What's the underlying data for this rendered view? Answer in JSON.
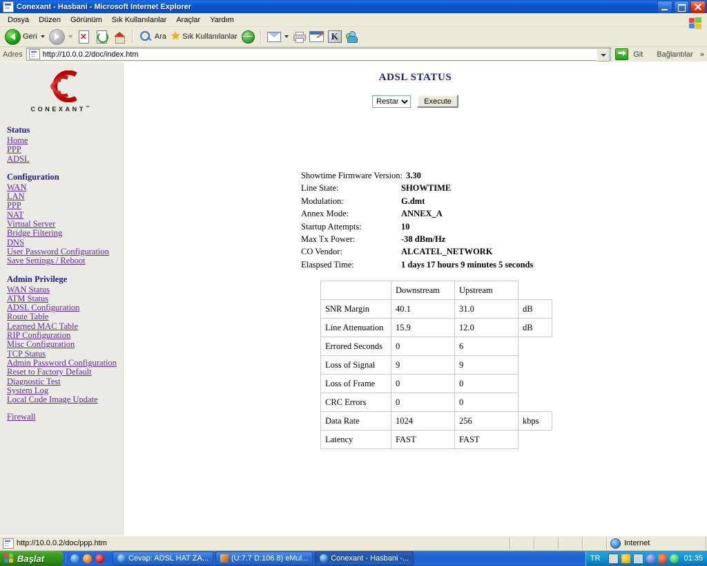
{
  "window": {
    "title": "Conexant - Hasbani - Microsoft Internet Explorer",
    "minimize": "_",
    "maximize": "□",
    "close": "✕"
  },
  "menu": {
    "items": [
      "Dosya",
      "Düzen",
      "Görünüm",
      "Sık Kullanılanlar",
      "Araçlar",
      "Yardım"
    ]
  },
  "toolbar": {
    "back_label": "Geri",
    "search_label": "Ara",
    "favorites_label": "Sık Kullanılanlar"
  },
  "address": {
    "label": "Adres",
    "url": "http://10.0.0.2/doc/index.htm",
    "go_label": "Git",
    "links_label": "Bağlantılar",
    "chevron": "»"
  },
  "sidebar": {
    "logo_text": "CONEXANT",
    "logo_tm": "™",
    "groups": [
      {
        "heading": "Status",
        "items": [
          "Home",
          "PPP",
          "ADSL"
        ]
      },
      {
        "heading": "Configuration",
        "items": [
          "WAN",
          "LAN",
          "PPP",
          "NAT",
          "Virtual Server",
          "Bridge Filtering",
          "DNS",
          "User Password Configuration",
          "Save Settings / Reboot"
        ]
      },
      {
        "heading": "Admin Privilege",
        "items": [
          "WAN Status",
          "ATM Status",
          "ADSL Configuration",
          "Route Table",
          "Learned MAC Table",
          "RIP Configuration",
          "Misc Configuration",
          "TCP Status",
          "Admin Password Configuration",
          "Reset to Factory Default",
          "Diagnostic Test",
          "System Log",
          "Local Code Image Update"
        ]
      },
      {
        "heading": "",
        "items": [
          "Firewall"
        ]
      }
    ]
  },
  "main": {
    "title": "ADSL STATUS",
    "action_select": {
      "selected": "Restart",
      "options": [
        "Restart"
      ]
    },
    "execute_button": "Execute",
    "info": [
      {
        "key": "Showtime Firmware Version:",
        "value": "3.30"
      },
      {
        "key": "Line State:",
        "value": "SHOWTIME"
      },
      {
        "key": "Modulation:",
        "value": "G.dmt"
      },
      {
        "key": "Annex Mode:",
        "value": "ANNEX_A"
      },
      {
        "key": "Startup Attempts:",
        "value": "10"
      },
      {
        "key": "Max Tx Power:",
        "value": "-38 dBm/Hz"
      },
      {
        "key": "CO Vendor:",
        "value": "ALCATEL_NETWORK"
      },
      {
        "key": "Elaspsed Time:",
        "value": "1 days 17 hours 9 minutes 5 seconds"
      }
    ],
    "table": {
      "headers": [
        "",
        "Downstream",
        "Upstream",
        ""
      ],
      "rows": [
        {
          "label": "SNR Margin",
          "down": "40.1",
          "up": "31.0",
          "unit": "dB"
        },
        {
          "label": "Line Attenuation",
          "down": "15.9",
          "up": "12.0",
          "unit": "dB"
        },
        {
          "label": "Errored Seconds",
          "down": "0",
          "up": "6",
          "unit": ""
        },
        {
          "label": "Loss of Signal",
          "down": "9",
          "up": "9",
          "unit": ""
        },
        {
          "label": "Loss of Frame",
          "down": "0",
          "up": "0",
          "unit": ""
        },
        {
          "label": "CRC Errors",
          "down": "0",
          "up": "0",
          "unit": ""
        },
        {
          "label": "Data Rate",
          "down": "1024",
          "up": "256",
          "unit": "kbps"
        },
        {
          "label": "Latency",
          "down": "FAST",
          "up": "FAST",
          "unit": ""
        }
      ]
    }
  },
  "statusbar": {
    "link_url": "http://10.0.0.2/doc/ppp.htm",
    "zone": "Internet"
  },
  "taskbar": {
    "start_label": "Başlat",
    "tasks": [
      {
        "label": "Cevap: ADSL HAT ZA...",
        "icon": "ie-icon",
        "active": false
      },
      {
        "label": "(U:7.7 D:106.8) eMul...",
        "icon": "emule-icon",
        "active": false
      },
      {
        "label": "Conexant - Hasbani -...",
        "icon": "ie-icon",
        "active": true
      }
    ],
    "language": "TR",
    "clock": "01:35"
  }
}
